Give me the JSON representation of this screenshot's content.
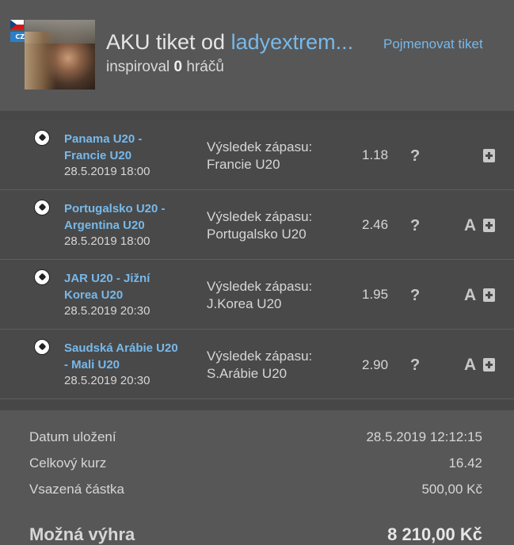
{
  "header": {
    "country_code": "CZ",
    "title_prefix": "AKU tiket od",
    "username": "ladyextrem...",
    "rename_label": "Pojmenovat tiket",
    "inspired_prefix": "inspiroval",
    "inspired_count": "0",
    "inspired_suffix": "hráčů"
  },
  "bets": [
    {
      "match_line1": "Panama U20 -",
      "match_line2": "Francie U20",
      "date": "28.5.2019 18:00",
      "bet_type": "Výsledek zápasu:",
      "pick": "Francie U20",
      "odds": "1.18",
      "status": "?",
      "a_label": ""
    },
    {
      "match_line1": "Portugalsko U20 -",
      "match_line2": "Argentina U20",
      "date": "28.5.2019 18:00",
      "bet_type": "Výsledek zápasu:",
      "pick": "Portugalsko U20",
      "odds": "2.46",
      "status": "?",
      "a_label": "A"
    },
    {
      "match_line1": "JAR U20 - Jižní",
      "match_line2": "Korea U20",
      "date": "28.5.2019 20:30",
      "bet_type": "Výsledek zápasu:",
      "pick": "J.Korea U20",
      "odds": "1.95",
      "status": "?",
      "a_label": "A"
    },
    {
      "match_line1": "Saudská Arábie U20",
      "match_line2": "- Mali U20",
      "date": "28.5.2019 20:30",
      "bet_type": "Výsledek zápasu:",
      "pick": "S.Arábie U20",
      "odds": "2.90",
      "status": "?",
      "a_label": "A"
    }
  ],
  "summary": {
    "saved_label": "Datum uložení",
    "saved_value": "28.5.2019 12:12:15",
    "total_odds_label": "Celkový kurz",
    "total_odds_value": "16.42",
    "stake_label": "Vsazená částka",
    "stake_value": "500,00 Kč",
    "win_label": "Možná výhra",
    "win_value": "8 210,00 Kč"
  },
  "colors": {
    "accent": "#77b9ea",
    "background": "#575757",
    "rows_background": "#494949"
  }
}
